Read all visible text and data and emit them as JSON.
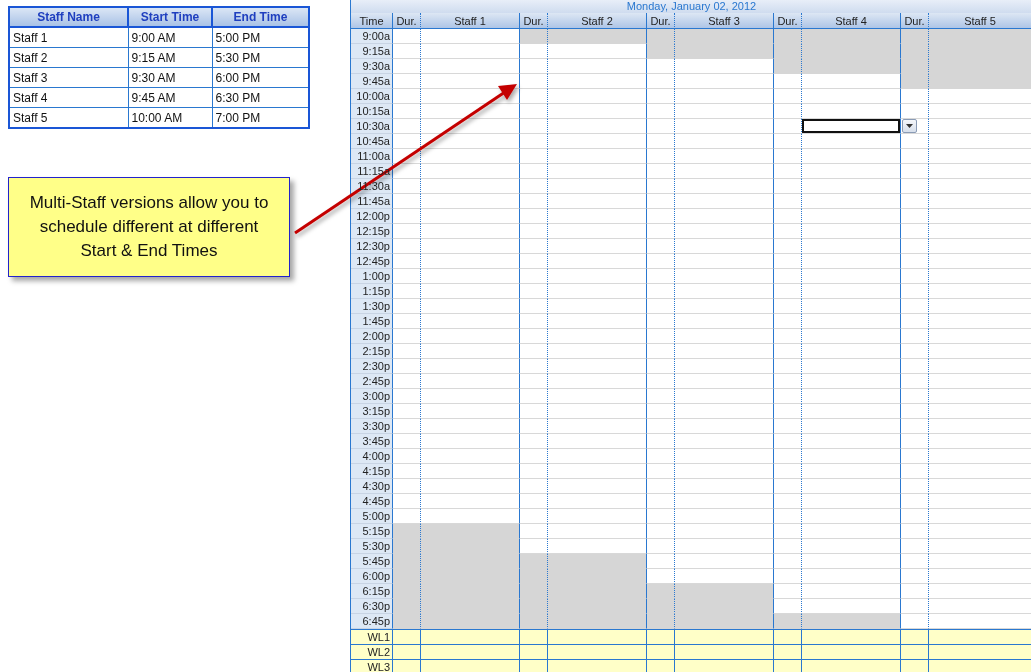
{
  "staff_table": {
    "columns": [
      "Staff Name",
      "Start Time",
      "End Time"
    ],
    "rows": [
      [
        "Staff 1",
        "9:00 AM",
        "5:00 PM"
      ],
      [
        "Staff 2",
        "9:15 AM",
        "5:30 PM"
      ],
      [
        "Staff 3",
        "9:30 AM",
        "6:00 PM"
      ],
      [
        "Staff 4",
        "9:45 AM",
        "6:30 PM"
      ],
      [
        "Staff 5",
        "10:00 AM",
        "7:00 PM"
      ]
    ]
  },
  "callout": {
    "text": "Multi-Staff versions allow you to schedule different at different Start & End Times"
  },
  "schedule": {
    "date": "Monday, January 02, 2012",
    "time_header": "Time",
    "staff_columns": [
      {
        "dur_label": "Dur.",
        "name": "Staff 1"
      },
      {
        "dur_label": "Dur.",
        "name": "Staff 2"
      },
      {
        "dur_label": "Dur.",
        "name": "Staff 3"
      },
      {
        "dur_label": "Dur.",
        "name": "Staff 4"
      },
      {
        "dur_label": "Dur.",
        "name": "Staff 5"
      }
    ],
    "rows": [
      {
        "time": "9:00a",
        "blocked": [
          false,
          true,
          true,
          true,
          true
        ]
      },
      {
        "time": "9:15a",
        "blocked": [
          false,
          false,
          true,
          true,
          true
        ]
      },
      {
        "time": "9:30a",
        "blocked": [
          false,
          false,
          false,
          true,
          true
        ]
      },
      {
        "time": "9:45a",
        "blocked": [
          false,
          false,
          false,
          false,
          true
        ]
      },
      {
        "time": "10:00a",
        "blocked": [
          false,
          false,
          false,
          false,
          false
        ]
      },
      {
        "time": "10:15a",
        "blocked": [
          false,
          false,
          false,
          false,
          false
        ]
      },
      {
        "time": "10:30a",
        "blocked": [
          false,
          false,
          false,
          false,
          false
        ],
        "selected": [
          false,
          false,
          false,
          true,
          false
        ]
      },
      {
        "time": "10:45a",
        "blocked": [
          false,
          false,
          false,
          false,
          false
        ]
      },
      {
        "time": "11:00a",
        "blocked": [
          false,
          false,
          false,
          false,
          false
        ]
      },
      {
        "time": "11:15a",
        "blocked": [
          false,
          false,
          false,
          false,
          false
        ]
      },
      {
        "time": "11:30a",
        "blocked": [
          false,
          false,
          false,
          false,
          false
        ]
      },
      {
        "time": "11:45a",
        "blocked": [
          false,
          false,
          false,
          false,
          false
        ]
      },
      {
        "time": "12:00p",
        "blocked": [
          false,
          false,
          false,
          false,
          false
        ]
      },
      {
        "time": "12:15p",
        "blocked": [
          false,
          false,
          false,
          false,
          false
        ]
      },
      {
        "time": "12:30p",
        "blocked": [
          false,
          false,
          false,
          false,
          false
        ]
      },
      {
        "time": "12:45p",
        "blocked": [
          false,
          false,
          false,
          false,
          false
        ]
      },
      {
        "time": "1:00p",
        "blocked": [
          false,
          false,
          false,
          false,
          false
        ]
      },
      {
        "time": "1:15p",
        "blocked": [
          false,
          false,
          false,
          false,
          false
        ]
      },
      {
        "time": "1:30p",
        "blocked": [
          false,
          false,
          false,
          false,
          false
        ]
      },
      {
        "time": "1:45p",
        "blocked": [
          false,
          false,
          false,
          false,
          false
        ]
      },
      {
        "time": "2:00p",
        "blocked": [
          false,
          false,
          false,
          false,
          false
        ]
      },
      {
        "time": "2:15p",
        "blocked": [
          false,
          false,
          false,
          false,
          false
        ]
      },
      {
        "time": "2:30p",
        "blocked": [
          false,
          false,
          false,
          false,
          false
        ]
      },
      {
        "time": "2:45p",
        "blocked": [
          false,
          false,
          false,
          false,
          false
        ]
      },
      {
        "time": "3:00p",
        "blocked": [
          false,
          false,
          false,
          false,
          false
        ]
      },
      {
        "time": "3:15p",
        "blocked": [
          false,
          false,
          false,
          false,
          false
        ]
      },
      {
        "time": "3:30p",
        "blocked": [
          false,
          false,
          false,
          false,
          false
        ]
      },
      {
        "time": "3:45p",
        "blocked": [
          false,
          false,
          false,
          false,
          false
        ]
      },
      {
        "time": "4:00p",
        "blocked": [
          false,
          false,
          false,
          false,
          false
        ]
      },
      {
        "time": "4:15p",
        "blocked": [
          false,
          false,
          false,
          false,
          false
        ]
      },
      {
        "time": "4:30p",
        "blocked": [
          false,
          false,
          false,
          false,
          false
        ]
      },
      {
        "time": "4:45p",
        "blocked": [
          false,
          false,
          false,
          false,
          false
        ]
      },
      {
        "time": "5:00p",
        "blocked": [
          false,
          false,
          false,
          false,
          false
        ]
      },
      {
        "time": "5:15p",
        "blocked": [
          true,
          false,
          false,
          false,
          false
        ]
      },
      {
        "time": "5:30p",
        "blocked": [
          true,
          false,
          false,
          false,
          false
        ]
      },
      {
        "time": "5:45p",
        "blocked": [
          true,
          true,
          false,
          false,
          false
        ]
      },
      {
        "time": "6:00p",
        "blocked": [
          true,
          true,
          false,
          false,
          false
        ]
      },
      {
        "time": "6:15p",
        "blocked": [
          true,
          true,
          true,
          false,
          false
        ]
      },
      {
        "time": "6:30p",
        "blocked": [
          true,
          true,
          true,
          false,
          false
        ]
      },
      {
        "time": "6:45p",
        "blocked": [
          true,
          true,
          true,
          true,
          false
        ]
      }
    ],
    "waitlist_rows": [
      "WL1",
      "WL2",
      "WL3"
    ]
  }
}
